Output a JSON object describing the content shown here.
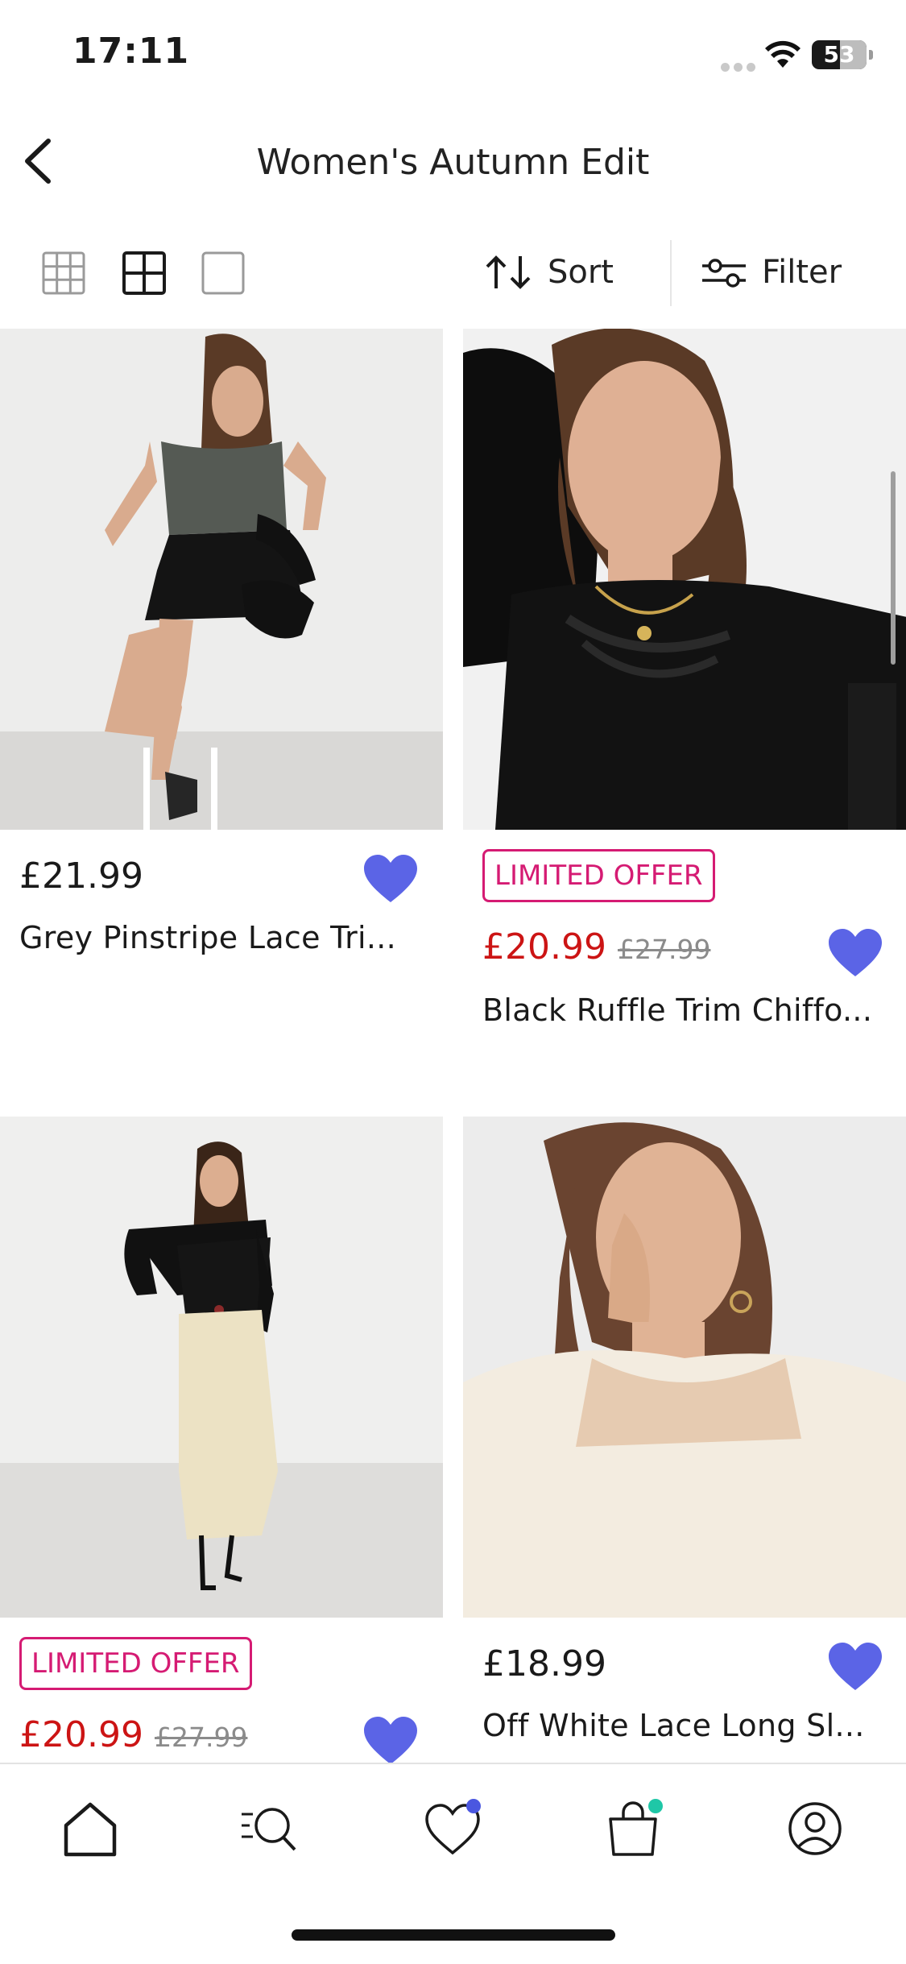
{
  "status_bar": {
    "time": "17:11",
    "battery": "53"
  },
  "header": {
    "title": "Women's Autumn Edit",
    "back_icon": "chevron-left-icon"
  },
  "toolbar": {
    "view_options": [
      "grid-small-icon",
      "grid-medium-icon",
      "grid-single-icon"
    ],
    "selected_view": "grid-medium-icon",
    "sort_label": "Sort",
    "filter_label": "Filter"
  },
  "products": [
    {
      "price": "£21.99",
      "name": "Grey Pinstripe Lace Tri...",
      "badge": "",
      "sale_price": "",
      "was_price": "",
      "wishlisted": true
    },
    {
      "price": "",
      "name": "Black Ruffle Trim Chiffo...",
      "badge": "LIMITED OFFER",
      "sale_price": "£20.99",
      "was_price": "£27.99",
      "wishlisted": true
    },
    {
      "price": "",
      "name": "",
      "badge": "LIMITED OFFER",
      "sale_price": "£20.99",
      "was_price": "£27.99",
      "wishlisted": true
    },
    {
      "price": "£18.99",
      "name": "Off White Lace Long Sl...",
      "badge": "",
      "sale_price": "",
      "was_price": "",
      "wishlisted": true
    }
  ],
  "tab_bar": {
    "items": [
      "home-icon",
      "search-icon",
      "wishlist-icon",
      "bag-icon",
      "account-icon"
    ],
    "selected": "home-icon"
  },
  "colors": {
    "heart": "#5b64e6",
    "badge": "#d51b73",
    "sale": "#cc1414",
    "wishlist_dot": "#4a57e0",
    "bag_dot": "#1fc7a7"
  }
}
